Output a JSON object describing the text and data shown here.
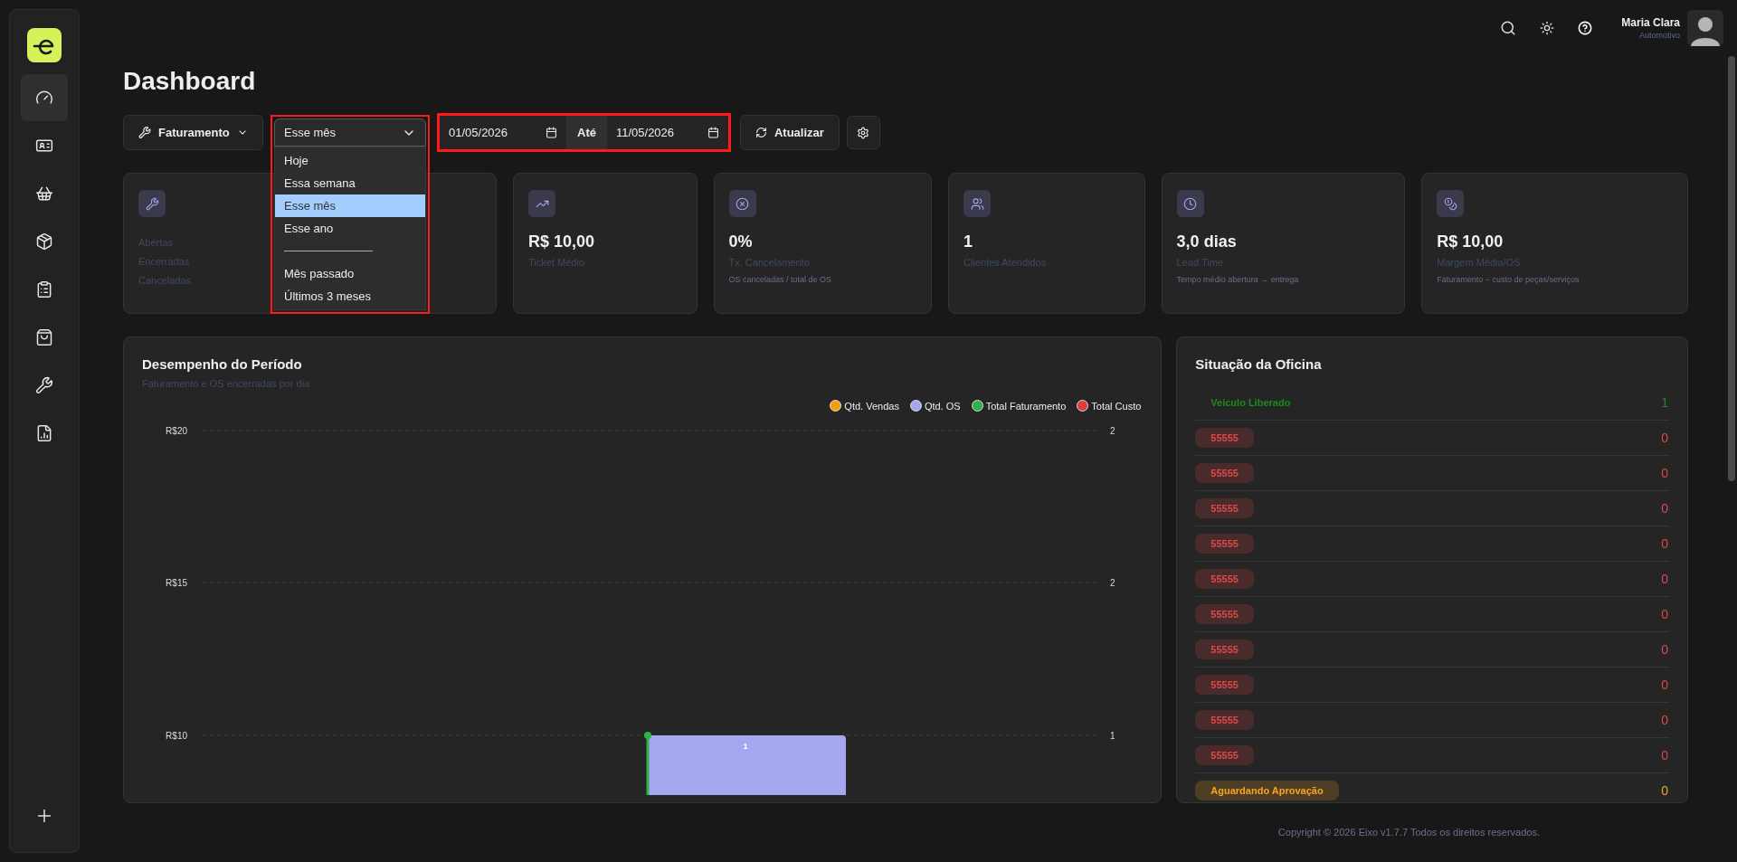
{
  "sidebar": {
    "items": [
      {
        "selected": true
      },
      {
        "selected": false
      },
      {
        "selected": false
      },
      {
        "selected": false
      },
      {
        "selected": false
      },
      {
        "selected": false
      },
      {
        "selected": false
      },
      {
        "selected": false
      }
    ]
  },
  "header": {
    "user_name": "Maria Clara",
    "user_role": "Automotivo"
  },
  "title": "Dashboard",
  "filters": {
    "report": "Faturamento",
    "period": {
      "value": "Esse mês",
      "highlighted": true,
      "expanded": true,
      "options": [
        {
          "kind": "option",
          "label": "Hoje",
          "selected": false
        },
        {
          "kind": "option",
          "label": "Essa semana",
          "selected": false
        },
        {
          "kind": "option",
          "label": "Esse mês",
          "selected": true
        },
        {
          "kind": "option",
          "label": "Esse ano",
          "selected": false
        },
        {
          "kind": "separator"
        },
        {
          "kind": "option",
          "label": "Mês passado",
          "selected": false
        },
        {
          "kind": "option",
          "label": "Últimos 3 meses",
          "selected": false
        }
      ]
    },
    "date_range": {
      "highlighted": true,
      "from": "01/05/2026",
      "to_label": "Até",
      "to": "11/05/2026"
    },
    "refresh": "Atualizar"
  },
  "cards": [
    {
      "kind": "list",
      "labels": [
        "Abertas",
        "Encerradas",
        "Canceladas"
      ]
    },
    {
      "kind": "stat",
      "value": "R$ 10,00",
      "label": "Ticket Médio"
    },
    {
      "kind": "stat",
      "value": "0%",
      "label": "Tx. Cancelamento",
      "note": "OS canceladas / total de OS"
    },
    {
      "kind": "stat",
      "value": "1",
      "label": "Clientes Atendidos"
    },
    {
      "kind": "stat",
      "value": "3,0 dias",
      "label": "Lead Time",
      "note": "Tempo médio abertura → entrega"
    },
    {
      "kind": "stat",
      "value": "R$ 10,00",
      "label": "Margem Média/OS",
      "note": "Faturamento − custo de peças/serviços"
    }
  ],
  "performance": {
    "title": "Desempenho do Período",
    "subtitle": "Faturamento e OS encerradas por dia",
    "legend": [
      {
        "label": "Qtd. Vendas",
        "color": "#f59e0b"
      },
      {
        "label": "Qtd. OS",
        "color": "#a5a6f0"
      },
      {
        "label": "Total Faturamento",
        "color": "#2fb344"
      },
      {
        "label": "Total Custo",
        "color": "#e03c3c"
      }
    ],
    "left_ticks": [
      "R$20",
      "R$15",
      "R$10"
    ],
    "right_ticks": [
      "2",
      "2",
      "1"
    ],
    "bar_label": "1"
  },
  "workshop": {
    "title": "Situação da Oficina",
    "rows": [
      {
        "kind": "plain",
        "label": "Veiculo Liberado",
        "count": "1",
        "color": "#1f8a1f"
      },
      {
        "kind": "badge",
        "label": "55555",
        "count": "0",
        "color": "#e04848"
      },
      {
        "kind": "badge",
        "label": "55555",
        "count": "0",
        "color": "#e04848"
      },
      {
        "kind": "badge",
        "label": "55555",
        "count": "0",
        "color": "#e04848"
      },
      {
        "kind": "badge",
        "label": "55555",
        "count": "0",
        "color": "#e04848"
      },
      {
        "kind": "badge",
        "label": "55555",
        "count": "0",
        "color": "#e04848"
      },
      {
        "kind": "badge",
        "label": "55555",
        "count": "0",
        "color": "#e04848"
      },
      {
        "kind": "badge",
        "label": "55555",
        "count": "0",
        "color": "#e04848"
      },
      {
        "kind": "badge",
        "label": "55555",
        "count": "0",
        "color": "#e04848"
      },
      {
        "kind": "badge",
        "label": "55555",
        "count": "0",
        "color": "#e04848"
      },
      {
        "kind": "badge",
        "label": "55555",
        "count": "0",
        "color": "#e04848"
      },
      {
        "kind": "badge",
        "label": "Aguardando Aprovação",
        "count": "0",
        "color": "#f5a524"
      }
    ]
  },
  "footer": "Copyright © 2026 Eixo v1.7.7 Todos os direitos reservados."
}
